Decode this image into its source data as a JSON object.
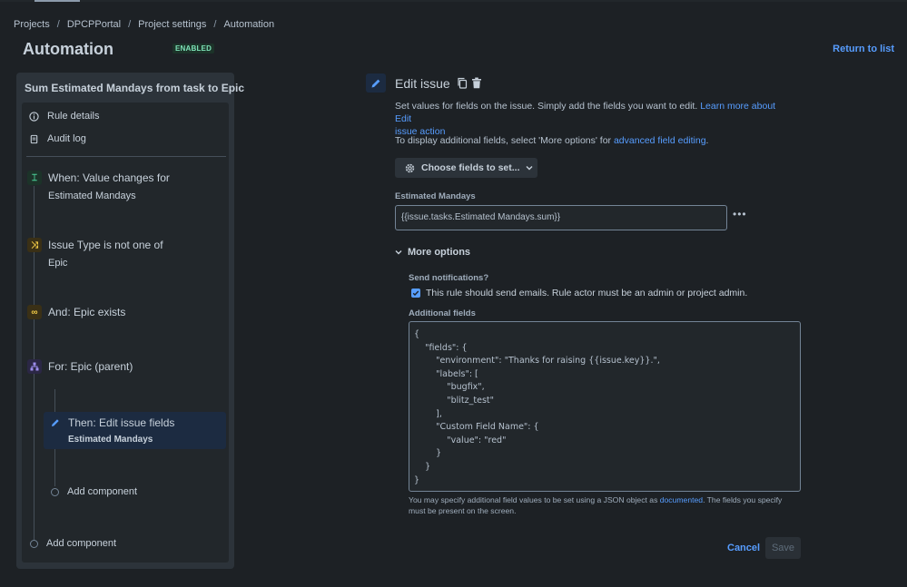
{
  "breadcrumb": [
    "Projects",
    "DPCPPortal",
    "Project settings",
    "Automation"
  ],
  "header": {
    "title": "Automation",
    "badge": "ENABLED",
    "return_link": "Return to list"
  },
  "rule": {
    "name": "Sum Estimated Mandays from task to Epic",
    "menu": [
      {
        "label": "Rule details",
        "icon": "info-icon"
      },
      {
        "label": "Audit log",
        "icon": "clipboard-icon"
      }
    ],
    "steps": [
      {
        "title": "When: Value changes for",
        "subtitle": "Estimated Mandays",
        "icon": "trigger-icon",
        "color": "#4bce97"
      },
      {
        "title": "Issue Type is not one of",
        "subtitle": "Epic",
        "icon": "condition-icon",
        "color": "#f5cd47"
      },
      {
        "title": "And: Epic exists",
        "icon": "link-icon",
        "color": "#f5cd47"
      },
      {
        "title": "For: Epic (parent)",
        "icon": "branch-icon",
        "color": "#9f8fef"
      },
      {
        "title": "Then: Edit issue fields",
        "subtitle": "Estimated Mandays",
        "icon": "pencil-icon",
        "color": "#579dff"
      }
    ],
    "add_component_inner": "Add component",
    "add_component_outer": "Add component"
  },
  "editor": {
    "title": "Edit issue",
    "desc_part1": "Set values for fields on the issue. Simply add the fields you want to edit. ",
    "desc_link1": "Learn more about Edit",
    "desc_link2": "issue action",
    "additional_part1": "To display additional fields, select 'More options' for ",
    "additional_link": "advanced field editing",
    "additional_part2": ".",
    "choose_fields": "Choose fields to set...",
    "field_label": "Estimated Mandays",
    "field_value": "{{issue.tasks.Estimated Mandays.sum}}",
    "more_options": "More options",
    "send_notifications_label": "Send notifications?",
    "send_notifications_text": "This rule should send emails. Rule actor must be an admin or project admin.",
    "additional_fields_label": "Additional fields",
    "json_lines": [
      "{",
      "    \"fields\": {",
      "        \"environment\": \"Thanks for raising {{issue.key}}.\",",
      "        \"labels\": [",
      "            \"bugfix\",",
      "            \"blitz_test\"",
      "        ],",
      "        \"Custom Field Name\": {",
      "            \"value\": \"red\"",
      "        }",
      "    }",
      "}"
    ],
    "help_part1": "You may specify additional field values to be set using a JSON object as ",
    "help_link": "documented",
    "help_part2": ". The fields you specify must be present on the screen.",
    "cancel": "Cancel",
    "save": "Save"
  },
  "colors": {
    "accent": "#579dff",
    "background": "#1d2125",
    "enabled": "#7ee2b8"
  }
}
